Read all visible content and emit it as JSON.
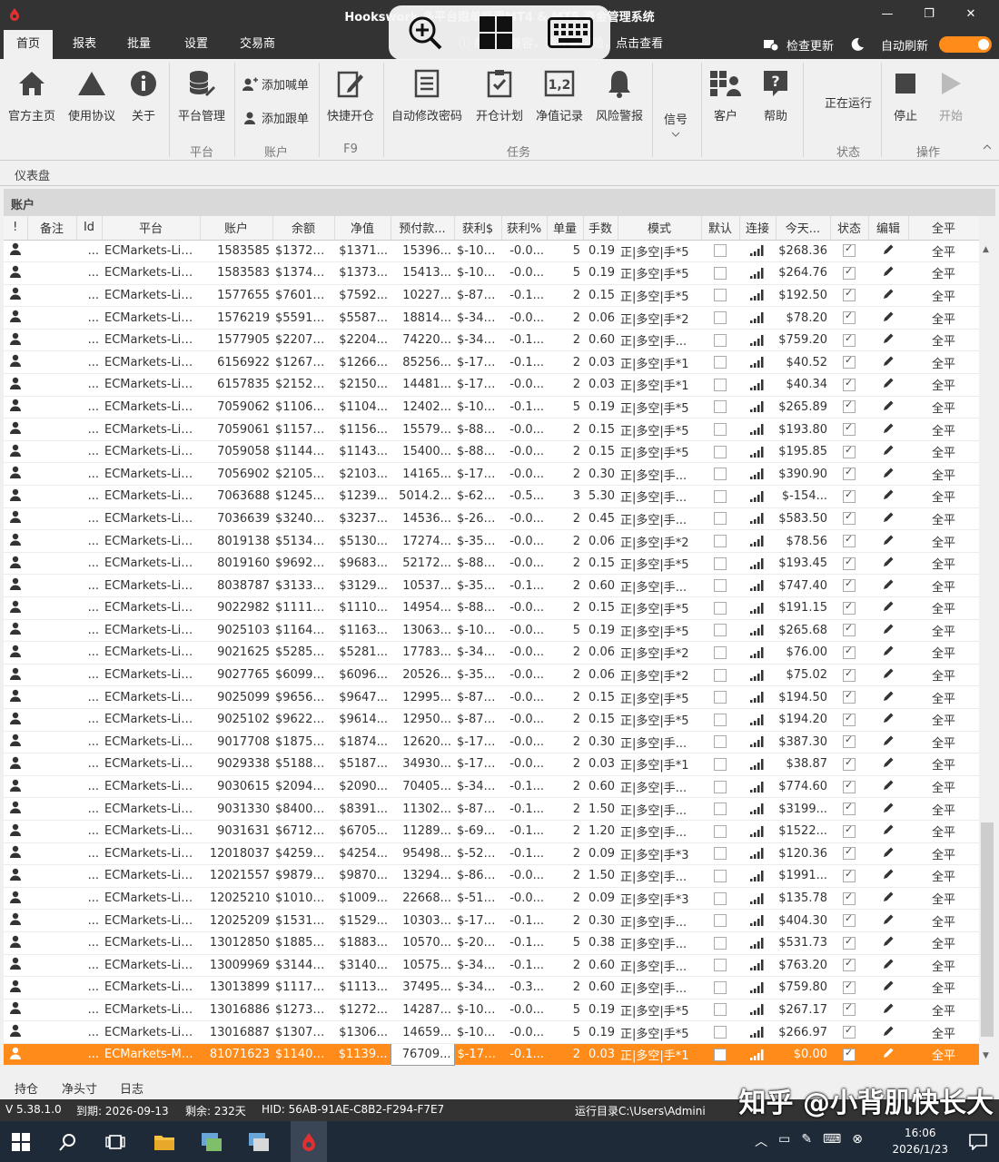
{
  "window": {
    "title": "Hookswork 多平台跟单管理MT4 & MT5 资金管理系统",
    "min": "—",
    "restore": "❐",
    "close": "✕"
  },
  "menu": {
    "tabs": [
      "首页",
      "报表",
      "批量",
      "设置",
      "交易商"
    ],
    "notice": "ⓘ 版本不兼容，请注意风险，点击查看",
    "check_update": "检查更新",
    "auto_refresh": "自动刷新"
  },
  "ribbon": {
    "home": "官方主页",
    "agreement": "使用协议",
    "about": "关于",
    "platform_mgmt": "平台管理",
    "group_platform": "平台",
    "add_master": "添加喊单",
    "add_follower": "添加跟单",
    "group_account": "账户",
    "quick_open": "快捷开仓",
    "group_f9": "F9",
    "auto_pwd": "自动修改密码",
    "open_plan": "开仓计划",
    "equity_log": "净值记录",
    "risk_alert": "风险警报",
    "group_task": "任务",
    "signal": "信号",
    "client": "客户",
    "help": "帮助",
    "running": "正在运行",
    "group_status": "状态",
    "stop": "停止",
    "start": "开始",
    "group_ops": "操作"
  },
  "dashboard_label": "仪表盘",
  "account_label": "账户",
  "table": {
    "headers": [
      "!",
      "备注",
      "Id",
      "平台",
      "账户",
      "余额",
      "净值",
      "预付款...",
      "获利$",
      "获利%",
      "单量",
      "手数",
      "模式",
      "默认",
      "连接",
      "今天...",
      "状态",
      "编辑",
      "全平"
    ],
    "rows": [
      [
        "ECMarkets-Liv...",
        "1583585",
        "$13726...",
        "$1371...",
        "15396...",
        "$-104...",
        "-0.0...",
        "5",
        "0.19",
        "正|多空|手*5",
        "$268.36"
      ],
      [
        "ECMarkets-Liv...",
        "1583583",
        "$13742...",
        "$1373...",
        "15413...",
        "$-104...",
        "-0.0...",
        "5",
        "0.19",
        "正|多空|手*5",
        "$264.76"
      ],
      [
        "ECMarkets-Liv...",
        "1577655",
        "$76016...",
        "$7592...",
        "10227...",
        "$-87.35",
        "-0.1...",
        "2",
        "0.15",
        "正|多空|手*5",
        "$192.50"
      ],
      [
        "ECMarkets-Liv...",
        "1576219",
        "$55913...",
        "$5587...",
        "18814...",
        "$-34.90",
        "-0.0...",
        "2",
        "0.06",
        "正|多空|手*2",
        "$78.20"
      ],
      [
        "ECMarkets-Liv...",
        "1577905",
        "$22076...",
        "$2204...",
        "74220...",
        "$-348...",
        "-0.1...",
        "2",
        "0.60",
        "正|多空|手...",
        "$759.20"
      ],
      [
        "ECMarkets-Liv...",
        "6156922",
        "$12678...",
        "$1266...",
        "85256...",
        "$-17.58",
        "-0.1...",
        "2",
        "0.03",
        "正|多空|手*1",
        "$40.52"
      ],
      [
        "ECMarkets-Liv...",
        "6157835",
        "$21523...",
        "$2150...",
        "14481...",
        "$-17.60",
        "-0.0...",
        "2",
        "0.03",
        "正|多空|手*1",
        "$40.34"
      ],
      [
        "ECMarkets-Liv...",
        "7059062",
        "$11060...",
        "$1104...",
        "12402...",
        "$-106...",
        "-0.1...",
        "5",
        "0.19",
        "正|多空|手*5",
        "$265.89"
      ],
      [
        "ECMarkets-Liv...",
        "7059061",
        "$11575...",
        "$1156...",
        "15579...",
        "$-88.65",
        "-0.0...",
        "2",
        "0.15",
        "正|多空|手*5",
        "$193.80"
      ],
      [
        "ECMarkets-Liv...",
        "7059058",
        "$11442...",
        "$1143...",
        "15400...",
        "$-88.50",
        "-0.0...",
        "2",
        "0.15",
        "正|多空|手*5",
        "$195.85"
      ],
      [
        "ECMarkets-Liv...",
        "7056902",
        "$21052...",
        "$2103...",
        "14165...",
        "$-177...",
        "-0.0...",
        "2",
        "0.30",
        "正|多空|手...",
        "$390.90"
      ],
      [
        "ECMarkets-Liv...",
        "7063688",
        "$12456...",
        "$1239...",
        "5014.2...",
        "$-622...",
        "-0.5...",
        "3",
        "5.30",
        "正|多空|手...",
        "$-154..."
      ],
      [
        "ECMarkets-Liv...",
        "7036639",
        "$32404...",
        "$3237...",
        "14536...",
        "$-265...",
        "-0.0...",
        "2",
        "0.45",
        "正|多空|手...",
        "$583.50"
      ],
      [
        "ECMarkets-Liv...",
        "8019138",
        "$51341...",
        "$5130...",
        "17274...",
        "$-35.44",
        "-0.0...",
        "2",
        "0.06",
        "正|多空|手*2",
        "$78.56"
      ],
      [
        "ECMarkets-Liv...",
        "8019160",
        "$96926...",
        "$9683...",
        "52172...",
        "$-88.60",
        "-0.0...",
        "2",
        "0.15",
        "正|多空|手*5",
        "$193.45"
      ],
      [
        "ECMarkets-Liv...",
        "8038787",
        "$31330...",
        "$3129...",
        "10537...",
        "$-354...",
        "-0.1...",
        "2",
        "0.60",
        "正|多空|手...",
        "$747.40"
      ],
      [
        "ECMarkets-Liv...",
        "9022982",
        "$11111...",
        "$1110...",
        "14954...",
        "$-88.70",
        "-0.0...",
        "2",
        "0.15",
        "正|多空|手*5",
        "$191.15"
      ],
      [
        "ECMarkets-Liv...",
        "9025103",
        "$11648...",
        "$1163...",
        "13063...",
        "$-104...",
        "-0.0...",
        "5",
        "0.19",
        "正|多空|手*5",
        "$265.68"
      ],
      [
        "ECMarkets-Liv...",
        "9021625",
        "$52852...",
        "$5281...",
        "17783...",
        "$-34.84",
        "-0.0...",
        "2",
        "0.06",
        "正|多空|手*2",
        "$76.00"
      ],
      [
        "ECMarkets-Liv...",
        "9027765",
        "$60999...",
        "$6096...",
        "20526...",
        "$-35.40",
        "-0.0...",
        "2",
        "0.06",
        "正|多空|手*2",
        "$75.02"
      ],
      [
        "ECMarkets-Liv...",
        "9025099",
        "$96566...",
        "$9647...",
        "12995...",
        "$-87.20",
        "-0.0...",
        "2",
        "0.15",
        "正|多空|手*5",
        "$194.50"
      ],
      [
        "ECMarkets-Liv...",
        "9025102",
        "$96228...",
        "$9614...",
        "12950...",
        "$-87.35",
        "-0.0...",
        "2",
        "0.15",
        "正|多空|手*5",
        "$194.20"
      ],
      [
        "ECMarkets-Liv...",
        "9017708",
        "$18757...",
        "$1874...",
        "12620...",
        "$-174...",
        "-0.0...",
        "2",
        "0.30",
        "正|多空|手...",
        "$387.30"
      ],
      [
        "ECMarkets-Liv...",
        "9029338",
        "$51888...",
        "$5187...",
        "34930...",
        "$-17.43",
        "-0.0...",
        "2",
        "0.03",
        "正|多空|手*1",
        "$38.87"
      ],
      [
        "ECMarkets-Liv...",
        "9030615",
        "$20943...",
        "$2090...",
        "70405...",
        "$-349...",
        "-0.1...",
        "2",
        "0.60",
        "正|多空|手...",
        "$774.60"
      ],
      [
        "ECMarkets-Liv...",
        "9031330",
        "$84003...",
        "$8391...",
        "11302...",
        "$-872...",
        "-0.1...",
        "2",
        "1.50",
        "正|多空|手...",
        "$3199..."
      ],
      [
        "ECMarkets-Liv...",
        "9031631",
        "$67122...",
        "$6705...",
        "11289...",
        "$-696...",
        "-0.1...",
        "2",
        "1.20",
        "正|多空|手...",
        "$1522..."
      ],
      [
        "ECMarkets-Liv...",
        "12018037",
        "$42596...",
        "$4254...",
        "95498...",
        "$-52.14",
        "-0.1...",
        "2",
        "0.09",
        "正|多空|手*3",
        "$120.36"
      ],
      [
        "ECMarkets-Liv...",
        "12021557",
        "$98793...",
        "$9870...",
        "13294...",
        "$-866...",
        "-0.0...",
        "2",
        "1.50",
        "正|多空|手...",
        "$1991..."
      ],
      [
        "ECMarkets-Liv...",
        "12025210",
        "$10104...",
        "$1009...",
        "22668...",
        "$-51.96",
        "-0.0...",
        "2",
        "0.09",
        "正|多空|手*3",
        "$135.78"
      ],
      [
        "ECMarkets-Liv...",
        "12025209",
        "$15316...",
        "$1529...",
        "10303...",
        "$-173...",
        "-0.1...",
        "2",
        "0.30",
        "正|多空|手...",
        "$404.30"
      ],
      [
        "ECMarkets-Liv...",
        "13012850",
        "$18854...",
        "$1883...",
        "10570...",
        "$-209...",
        "-0.1...",
        "5",
        "0.38",
        "正|多空|手...",
        "$531.73"
      ],
      [
        "ECMarkets-Liv...",
        "13009969",
        "$31442...",
        "$3140...",
        "10575...",
        "$-349...",
        "-0.1...",
        "2",
        "0.60",
        "正|多空|手...",
        "$763.20"
      ],
      [
        "ECMarkets-Liv...",
        "13013899",
        "$11170...",
        "$1113...",
        "37495...",
        "$-348...",
        "-0.3...",
        "2",
        "0.60",
        "正|多空|手...",
        "$759.80"
      ],
      [
        "ECMarkets-Liv...",
        "13016886",
        "$12739...",
        "$1272...",
        "14287...",
        "$-104...",
        "-0.0...",
        "5",
        "0.19",
        "正|多空|手*5",
        "$267.17"
      ],
      [
        "ECMarkets-Liv...",
        "13016887",
        "$13070...",
        "$1306...",
        "14659...",
        "$-104...",
        "-0.0...",
        "5",
        "0.19",
        "正|多空|手*5",
        "$266.97"
      ],
      [
        "ECMarkets-MT...",
        "81071623",
        "$11407...",
        "$1139...",
        "76709...",
        "$-17.25",
        "-0.1...",
        "2",
        "0.03",
        "正|多空|手*1",
        "$0.00"
      ]
    ],
    "dots": "...",
    "close_all": "全平"
  },
  "bottom_tabs": [
    "持仓",
    "净头寸",
    "日志"
  ],
  "status": {
    "version": "V 5.38.1.0",
    "expiry": "到期: 2026-09-13",
    "remaining": "剩余: 232天",
    "hid": "HID: 56AB-91AE-C8B2-F294-F7E7",
    "run_dir": "运行目录C:\\Users\\Admini"
  },
  "watermark": "知乎 @小背肌快长大",
  "taskbar": {
    "time": "16:06",
    "date": "2026/1/23"
  },
  "colors": {
    "accent": "#ff8c1a",
    "titlebar": "#333333",
    "taskbar": "#1f2a38"
  }
}
